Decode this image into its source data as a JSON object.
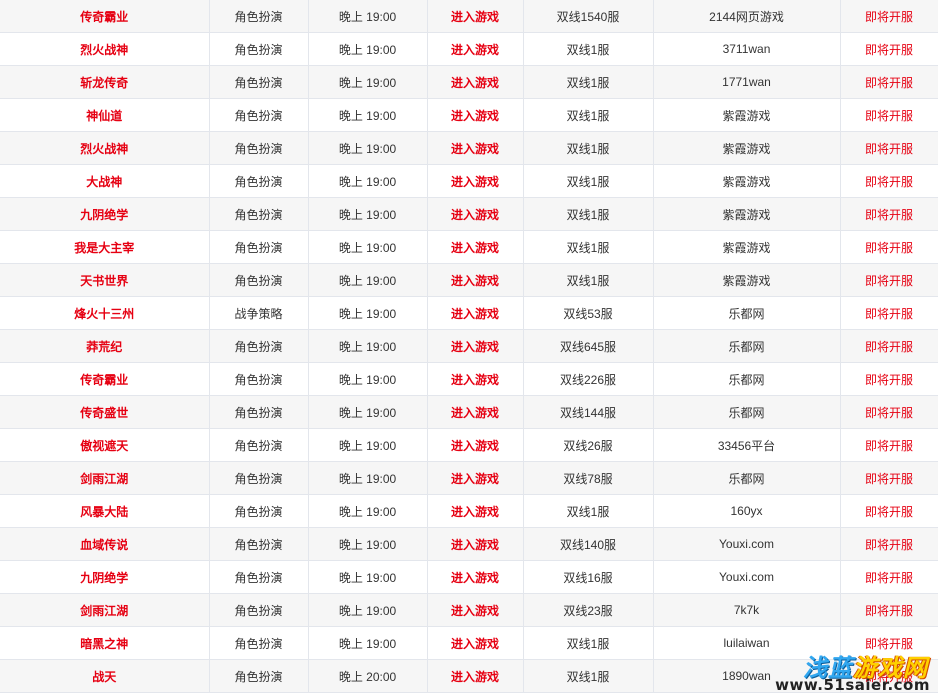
{
  "columns": [
    "game_name",
    "category",
    "open_time",
    "enter_label",
    "server",
    "platform",
    "status"
  ],
  "rows": [
    {
      "name": "传奇霸业",
      "category": "角色扮演",
      "time": "晚上 19:00",
      "enter": "进入游戏",
      "server": "双线1540服",
      "platform": "2144网页游戏",
      "status": "即将开服"
    },
    {
      "name": "烈火战神",
      "category": "角色扮演",
      "time": "晚上 19:00",
      "enter": "进入游戏",
      "server": "双线1服",
      "platform": "3711wan",
      "status": "即将开服"
    },
    {
      "name": "斩龙传奇",
      "category": "角色扮演",
      "time": "晚上 19:00",
      "enter": "进入游戏",
      "server": "双线1服",
      "platform": "1771wan",
      "status": "即将开服"
    },
    {
      "name": "神仙道",
      "category": "角色扮演",
      "time": "晚上 19:00",
      "enter": "进入游戏",
      "server": "双线1服",
      "platform": "紫霞游戏",
      "status": "即将开服"
    },
    {
      "name": "烈火战神",
      "category": "角色扮演",
      "time": "晚上 19:00",
      "enter": "进入游戏",
      "server": "双线1服",
      "platform": "紫霞游戏",
      "status": "即将开服"
    },
    {
      "name": "大战神",
      "category": "角色扮演",
      "time": "晚上 19:00",
      "enter": "进入游戏",
      "server": "双线1服",
      "platform": "紫霞游戏",
      "status": "即将开服"
    },
    {
      "name": "九阴绝学",
      "category": "角色扮演",
      "time": "晚上 19:00",
      "enter": "进入游戏",
      "server": "双线1服",
      "platform": "紫霞游戏",
      "status": "即将开服"
    },
    {
      "name": "我是大主宰",
      "category": "角色扮演",
      "time": "晚上 19:00",
      "enter": "进入游戏",
      "server": "双线1服",
      "platform": "紫霞游戏",
      "status": "即将开服"
    },
    {
      "name": "天书世界",
      "category": "角色扮演",
      "time": "晚上 19:00",
      "enter": "进入游戏",
      "server": "双线1服",
      "platform": "紫霞游戏",
      "status": "即将开服"
    },
    {
      "name": "烽火十三州",
      "category": "战争策略",
      "time": "晚上 19:00",
      "enter": "进入游戏",
      "server": "双线53服",
      "platform": "乐都网",
      "status": "即将开服"
    },
    {
      "name": "莽荒纪",
      "category": "角色扮演",
      "time": "晚上 19:00",
      "enter": "进入游戏",
      "server": "双线645服",
      "platform": "乐都网",
      "status": "即将开服"
    },
    {
      "name": "传奇霸业",
      "category": "角色扮演",
      "time": "晚上 19:00",
      "enter": "进入游戏",
      "server": "双线226服",
      "platform": "乐都网",
      "status": "即将开服"
    },
    {
      "name": "传奇盛世",
      "category": "角色扮演",
      "time": "晚上 19:00",
      "enter": "进入游戏",
      "server": "双线144服",
      "platform": "乐都网",
      "status": "即将开服"
    },
    {
      "name": "傲视遮天",
      "category": "角色扮演",
      "time": "晚上 19:00",
      "enter": "进入游戏",
      "server": "双线26服",
      "platform": "33456平台",
      "status": "即将开服"
    },
    {
      "name": "剑雨江湖",
      "category": "角色扮演",
      "time": "晚上 19:00",
      "enter": "进入游戏",
      "server": "双线78服",
      "platform": "乐都网",
      "status": "即将开服"
    },
    {
      "name": "风暴大陆",
      "category": "角色扮演",
      "time": "晚上 19:00",
      "enter": "进入游戏",
      "server": "双线1服",
      "platform": "160yx",
      "status": "即将开服"
    },
    {
      "name": "血域传说",
      "category": "角色扮演",
      "time": "晚上 19:00",
      "enter": "进入游戏",
      "server": "双线140服",
      "platform": "Youxi.com",
      "status": "即将开服"
    },
    {
      "name": "九阴绝学",
      "category": "角色扮演",
      "time": "晚上 19:00",
      "enter": "进入游戏",
      "server": "双线16服",
      "platform": "Youxi.com",
      "status": "即将开服"
    },
    {
      "name": "剑雨江湖",
      "category": "角色扮演",
      "time": "晚上 19:00",
      "enter": "进入游戏",
      "server": "双线23服",
      "platform": "7k7k",
      "status": "即将开服"
    },
    {
      "name": "暗黑之神",
      "category": "角色扮演",
      "time": "晚上 19:00",
      "enter": "进入游戏",
      "server": "双线1服",
      "platform": "luilaiwan",
      "status": "即将开服"
    },
    {
      "name": "战天",
      "category": "角色扮演",
      "time": "晚上 20:00",
      "enter": "进入游戏",
      "server": "双线1服",
      "platform": "1890wan",
      "status": "即将开服"
    }
  ],
  "watermark": {
    "brand_part1": "浅蓝",
    "brand_part2": "游戏网",
    "url": "www.51saier.com"
  },
  "colors": {
    "accent_red": "#e60012",
    "row_alt": "#f6f6f6",
    "border": "#e3e6ec"
  }
}
